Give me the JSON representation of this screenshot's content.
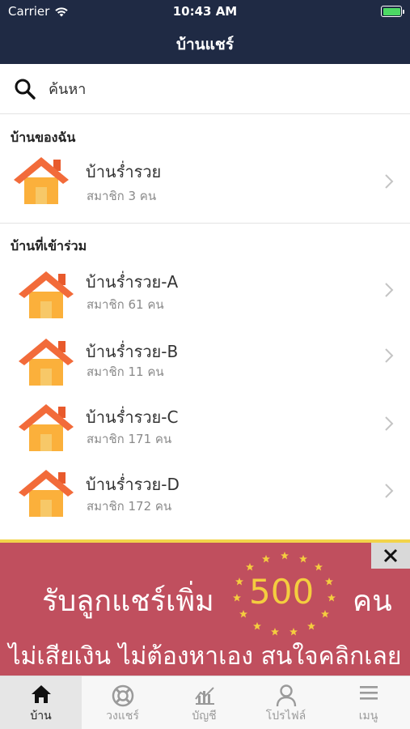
{
  "status_bar": {
    "carrier": "Carrier",
    "time": "10:43 AM"
  },
  "nav": {
    "title": "บ้านแชร์"
  },
  "search": {
    "placeholder": "ค้นหา"
  },
  "my_house": {
    "header": "บ้านของฉัน",
    "items": [
      {
        "title": "บ้านร่ำรวย",
        "members": "สมาชิก 3 คน"
      }
    ]
  },
  "joined": {
    "header": "บ้านที่เข้าร่วม",
    "items": [
      {
        "title": "บ้านร่ำรวย-A",
        "members": "สมาชิก 61 คน"
      },
      {
        "title": "บ้านร่ำรวย-B",
        "members": "สมาชิก 11 คน"
      },
      {
        "title": "บ้านร่ำรวย-C",
        "members": "สมาชิก 171 คน"
      },
      {
        "title": "บ้านร่ำรวย-D",
        "members": "สมาชิก 172 คน"
      }
    ]
  },
  "banner": {
    "line1_left": "รับลูกแชร์เพิ่ม",
    "number": "500",
    "line1_right": "คน",
    "line2": "ไม่เสียเงิน ไม่ต้องหาเอง สนใจคลิกเลย"
  },
  "tabs": [
    {
      "label": "บ้าน",
      "icon": "home-icon"
    },
    {
      "label": "วงแชร์",
      "icon": "lifebuoy-icon"
    },
    {
      "label": "บัญชี",
      "icon": "chart-icon"
    },
    {
      "label": "โปรไฟล์",
      "icon": "person-icon"
    },
    {
      "label": "เมนู",
      "icon": "menu-icon"
    }
  ],
  "colors": {
    "nav_background": "#1f2a44",
    "banner_background": "#c04f5e",
    "banner_accent": "#f4cd3f",
    "house_roof": "#f26b3a",
    "house_body": "#fbb03b"
  }
}
